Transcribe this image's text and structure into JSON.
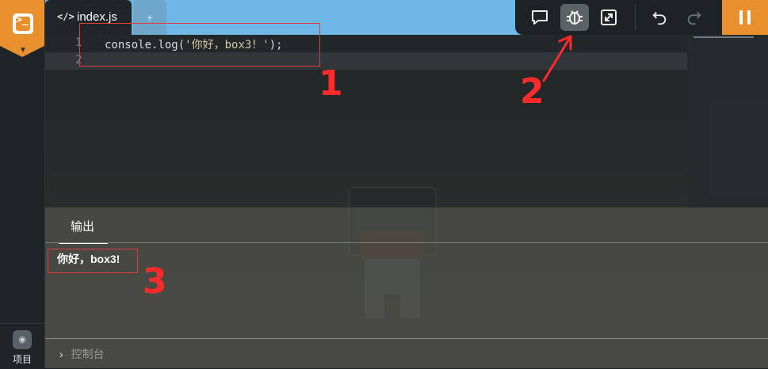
{
  "sidebar": {
    "logo_icon": "terminal-icon",
    "project_label": "项目",
    "project_icon": "eye-icon"
  },
  "tabs": {
    "active": {
      "icon": "code-icon",
      "glyph": "</>",
      "label": "index.js"
    },
    "add": {
      "glyph": "+"
    }
  },
  "editor": {
    "lines": [
      {
        "number": "1",
        "prefix": "console.log(",
        "string": "'你好，box3！'",
        "suffix": ");"
      },
      {
        "number": "2",
        "prefix": "",
        "string": "",
        "suffix": ""
      }
    ]
  },
  "toolbar": {
    "buttons": [
      {
        "name": "comment-icon",
        "glyph": "💬"
      },
      {
        "name": "bug-icon",
        "glyph": "🐞",
        "selected": true
      },
      {
        "name": "fullscreen-icon",
        "glyph": "⤢"
      },
      {
        "name": "undo-icon",
        "glyph": "↶"
      },
      {
        "name": "redo-icon",
        "glyph": "↷",
        "disabled": true
      }
    ],
    "pause_icon": "pause-icon"
  },
  "output": {
    "tab_label": "输出",
    "text": "你好，box3!",
    "console_label": "控制台"
  },
  "annotations": {
    "label_1": "1",
    "label_2": "2",
    "label_3": "3",
    "color": "#ff2a2a"
  },
  "colors": {
    "accent": "#e8902e",
    "sky": "#6fb7e6"
  }
}
